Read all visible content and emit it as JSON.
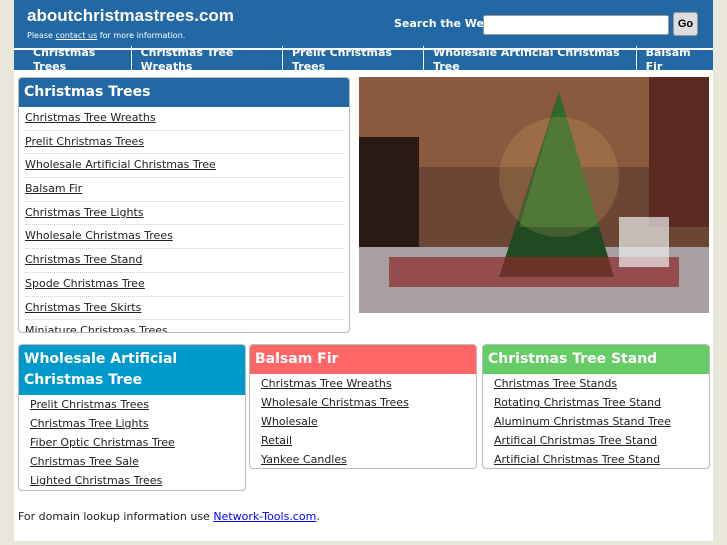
{
  "header": {
    "title": "aboutchristmastrees.com",
    "tagline_pre": "Please ",
    "tagline_link": "contact us",
    "tagline_post": " for more information.",
    "search_label": "Search the Web:",
    "search_value": "",
    "go_label": "Go"
  },
  "nav": [
    "Christmas Trees",
    "Christmas Tree Wreaths",
    "Prelit Christmas Trees",
    "Wholesale Artificial Christmas Tree",
    "Balsam Fir"
  ],
  "main_box": {
    "title": "Christmas Trees",
    "color": "#2268a4",
    "links": [
      "Christmas Tree Wreaths",
      "Prelit Christmas Trees",
      "Wholesale Artificial Christmas Tree",
      "Balsam Fir",
      "Christmas Tree Lights",
      "Wholesale Christmas Trees",
      "Christmas Tree Stand",
      "Spode Christmas Tree",
      "Christmas Tree Skirts",
      "Miniature Christmas Trees"
    ]
  },
  "boxes": [
    {
      "title": "Wholesale Artificial Christmas Tree",
      "color": "#0099cc",
      "links": [
        "Prelit Christmas Trees",
        "Christmas Tree Lights",
        "Fiber Optic Christmas Tree",
        "Christmas Tree Sale",
        "Lighted Christmas Trees"
      ]
    },
    {
      "title": "Balsam Fir",
      "color": "#ff6666",
      "links": [
        "Christmas Tree Wreaths",
        "Wholesale Christmas Trees",
        "Wholesale",
        "Retail",
        "Yankee Candles"
      ]
    },
    {
      "title": "Christmas Tree Stand",
      "color": "#66cc66",
      "links": [
        "Christmas Tree Stands",
        "Rotating Christmas Tree Stand",
        "Aluminum Christmas Stand Tree",
        "Artifical Christmas Tree Stand",
        "Artificial Christmas Tree Stand"
      ]
    }
  ],
  "footer": {
    "text": "For domain lookup information use ",
    "link": "Network-Tools.com",
    "end": "."
  }
}
